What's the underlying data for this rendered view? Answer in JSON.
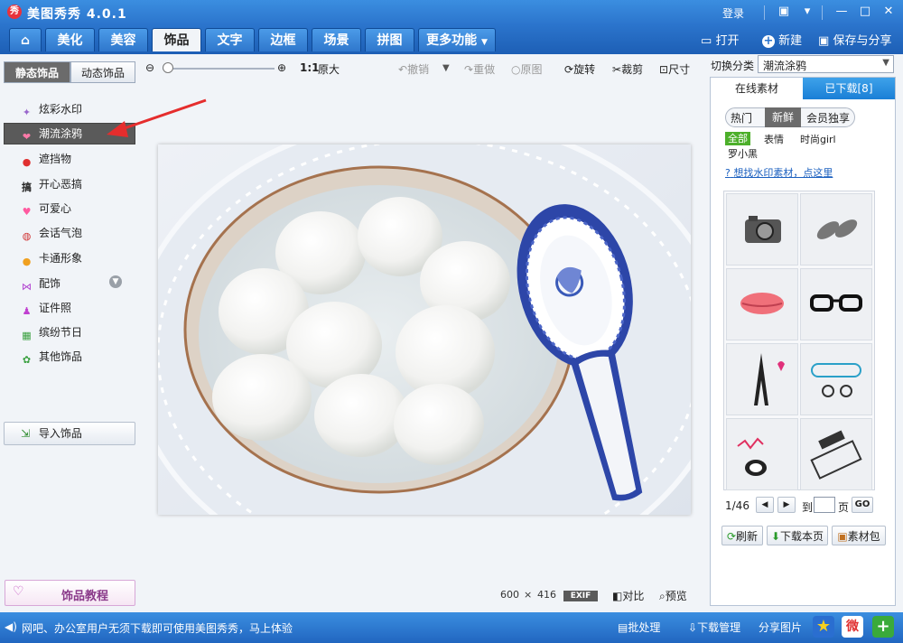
{
  "app": {
    "title": "美图秀秀 4.0.1",
    "logo_text": "秀"
  },
  "window": {
    "login_label": "登录"
  },
  "tabs": [
    {
      "label": "美化"
    },
    {
      "label": "美容"
    },
    {
      "label": "饰品"
    },
    {
      "label": "文字"
    },
    {
      "label": "边框"
    },
    {
      "label": "场景"
    },
    {
      "label": "拼图"
    },
    {
      "label": "更多功能"
    }
  ],
  "top_actions": {
    "open": "打开",
    "new": "新建",
    "save_share": "保存与分享"
  },
  "left": {
    "subtabs": [
      "静态饰品",
      "动态饰品"
    ],
    "items": [
      "炫彩水印",
      "潮流涂鸦",
      "遮挡物",
      "开心恶搞",
      "可爱心",
      "会话气泡",
      "卡通形象",
      "配饰",
      "证件照",
      "缤纷节日",
      "其他饰品"
    ],
    "import_label": "导入饰品",
    "tutorial_label": "饰品教程"
  },
  "toolbar": {
    "ratio": "1:1",
    "original_size": "原大",
    "undo": "撤销",
    "redo": "重做",
    "original": "原图",
    "rotate": "旋转",
    "crop": "裁剪",
    "size": "尺寸"
  },
  "canvas": {
    "width_value": "600",
    "times": "×",
    "height_value": "416",
    "exif": "EXIF",
    "compare": "对比",
    "preview": "预览"
  },
  "right": {
    "switch_label": "切换分类",
    "category_value": "潮流涂鸦",
    "tabs": [
      "在线素材",
      "已下载[8]"
    ],
    "filters": [
      "热门",
      "新鲜",
      "会员独享"
    ],
    "tags": [
      "全部",
      "表情",
      "时尚girl",
      "罗小黑"
    ],
    "watermark_link": "想找水印素材，点这里",
    "page_current": "1/46",
    "goto_label": "到",
    "page_suffix": "页",
    "go_label": "GO",
    "refresh": "刷新",
    "download_page": "下载本页",
    "material_pack": "素材包"
  },
  "status": {
    "message": "网吧、办公室用户无须下载即可使用美图秀秀，马上体验",
    "batch": "批处理",
    "download_manage": "下载管理",
    "share_image": "分享图片"
  },
  "colors": {
    "title_blue": "#2b74cc",
    "selected_item": "#5a5a5a",
    "tag_green": "#4caf2a",
    "arrow_red": "#e52d2d"
  }
}
